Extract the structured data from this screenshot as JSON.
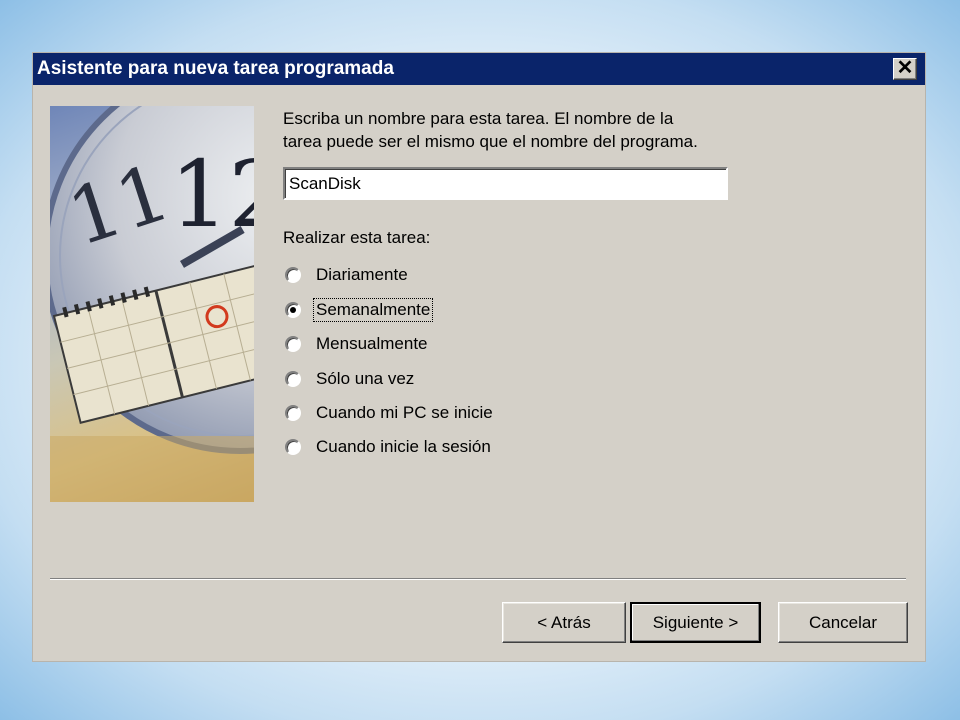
{
  "window": {
    "title": "Asistente para nueva tarea programada",
    "close_glyph": "✕"
  },
  "instructions": {
    "line1": "Escriba un nombre para esta tarea. El nombre de la",
    "line2": "tarea puede ser el mismo que el nombre del programa."
  },
  "task_name": {
    "value": "ScanDisk"
  },
  "schedule": {
    "label": "Realizar esta tarea:",
    "options": [
      {
        "label": "Diariamente",
        "checked": false
      },
      {
        "label": "Semanalmente",
        "checked": true
      },
      {
        "label": "Mensualmente",
        "checked": false
      },
      {
        "label": "Sólo una vez",
        "checked": false
      },
      {
        "label": "Cuando mi PC se inicie",
        "checked": false
      },
      {
        "label": "Cuando inicie la sesión",
        "checked": false
      }
    ]
  },
  "buttons": {
    "back": "< Atrás",
    "next": "Siguiente >",
    "cancel": "Cancelar"
  },
  "art": {
    "clock_numerals": [
      "11",
      "12"
    ]
  },
  "colors": {
    "titlebar": "#0a246a",
    "dialog_face": "#d4d0c8"
  }
}
